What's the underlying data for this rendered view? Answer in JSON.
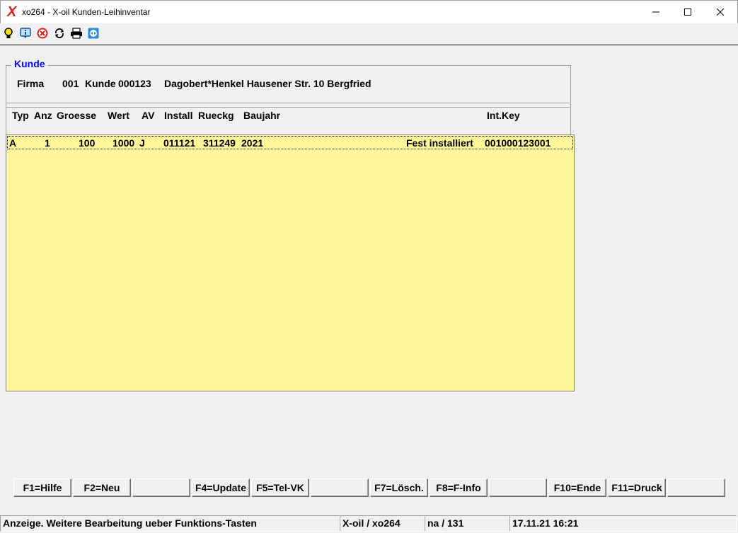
{
  "window": {
    "title": "xo264 - X-oil Kunden-Leihinventar",
    "minimize": "—",
    "maximize": "☐",
    "close": "✕"
  },
  "toolbar": {
    "icons": [
      "lightbulb-icon",
      "info-icon",
      "cancel-icon",
      "refresh-icon",
      "print-icon",
      "teamviewer-icon"
    ]
  },
  "customer": {
    "legend": "Kunde",
    "firma_label": "Firma",
    "firma_value": "001",
    "kunde_label": "Kunde",
    "kunde_value": "000123",
    "name": "Dagobert*Henkel Hausener Str. 10 Bergfried"
  },
  "table": {
    "headers": [
      "Typ",
      "Anz",
      "Groesse",
      "Wert",
      "AV",
      "Install",
      "Rueckg",
      "Baujahr",
      "Int.Key"
    ],
    "rows": [
      {
        "typ": "A",
        "anz": "1",
        "groesse": "100",
        "wert": "1000",
        "av": "J",
        "install": "011121",
        "rueckg": "311249",
        "baujahr": "2021",
        "status": "Fest installiert",
        "intkey": "001000123001"
      }
    ]
  },
  "fkeys": [
    "F1=Hilfe",
    "F2=Neu",
    "",
    "F4=Update",
    "F5=Tel-VK",
    "",
    "F7=Lösch.",
    "F8=F-Info",
    "",
    "F10=Ende",
    "F11=Druck",
    ""
  ],
  "statusbar": {
    "message": "Anzeige. Weitere Bearbeitung ueber Funktions-Tasten",
    "program": "X-oil / xo264",
    "user": "na / 131",
    "datetime": "17.11.21 16:21"
  }
}
